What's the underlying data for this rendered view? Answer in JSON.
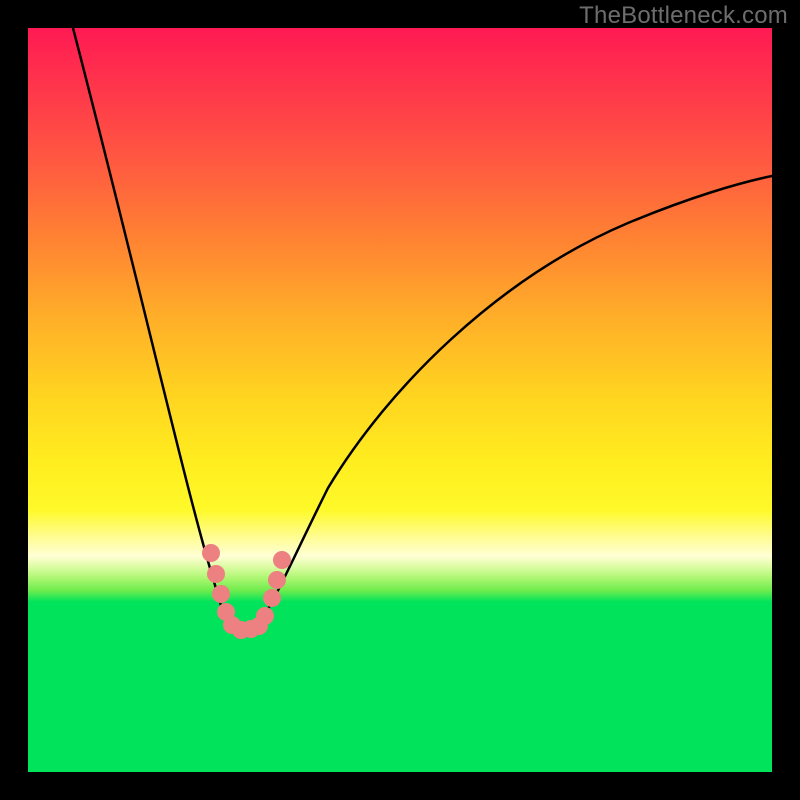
{
  "watermark": "TheBottleneck.com",
  "chart_data": {
    "type": "line",
    "title": "",
    "xlabel": "",
    "ylabel": "",
    "xlim": [
      0,
      100
    ],
    "ylim": [
      0,
      100
    ],
    "series": [
      {
        "name": "left-curve",
        "x": [
          6,
          8,
          10,
          12,
          14,
          16,
          18,
          20,
          22,
          24,
          26,
          27,
          27.5
        ],
        "values": [
          100,
          88,
          76,
          64,
          52,
          42,
          33,
          25,
          18,
          12,
          6,
          1,
          0
        ]
      },
      {
        "name": "right-curve",
        "x": [
          31.5,
          32,
          34,
          38,
          42,
          48,
          55,
          63,
          72,
          82,
          92,
          100
        ],
        "values": [
          0,
          1,
          6,
          14,
          22,
          32,
          42,
          51,
          60,
          68,
          75,
          80
        ]
      }
    ],
    "markers": {
      "name": "salmon-points",
      "color": "#ed8080",
      "points": [
        {
          "x": 24.6,
          "y": 13
        },
        {
          "x": 25.3,
          "y": 10
        },
        {
          "x": 26.0,
          "y": 6.5
        },
        {
          "x": 26.5,
          "y": 3.5
        },
        {
          "x": 27.3,
          "y": 1.4
        },
        {
          "x": 28.5,
          "y": 0.7
        },
        {
          "x": 29.8,
          "y": 0.7
        },
        {
          "x": 31.0,
          "y": 0.9
        },
        {
          "x": 31.8,
          "y": 2.2
        },
        {
          "x": 32.7,
          "y": 5.5
        },
        {
          "x": 33.3,
          "y": 8.5
        },
        {
          "x": 34.0,
          "y": 12
        }
      ]
    },
    "gradient_stops": [
      {
        "pos": 0,
        "color": "#ff1a53"
      },
      {
        "pos": 50,
        "color": "#ffad29"
      },
      {
        "pos": 84,
        "color": "#fff92a"
      },
      {
        "pos": 100,
        "color": "#00e35a"
      }
    ]
  }
}
